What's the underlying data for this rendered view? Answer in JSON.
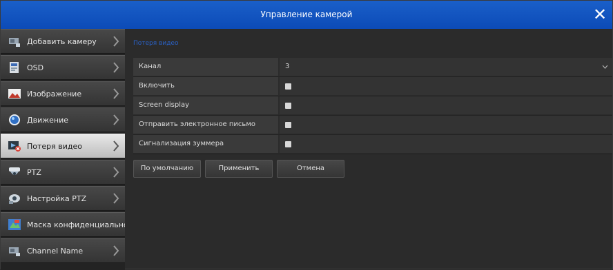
{
  "window": {
    "title": "Управление камерой",
    "close_icon": "close-icon"
  },
  "sidebar": {
    "items": [
      {
        "label": "Добавить камеру",
        "icon": "add-camera-icon",
        "active": false
      },
      {
        "label": "OSD",
        "icon": "osd-icon",
        "active": false
      },
      {
        "label": "Изображение",
        "icon": "image-icon",
        "active": false
      },
      {
        "label": "Движение",
        "icon": "motion-icon",
        "active": false
      },
      {
        "label": "Потеря видео",
        "icon": "video-loss-icon",
        "active": true
      },
      {
        "label": "PTZ",
        "icon": "ptz-icon",
        "active": false
      },
      {
        "label": "Настройка PTZ",
        "icon": "ptz-settings-icon",
        "active": false
      },
      {
        "label": "Маска конфиденциальнос",
        "icon": "privacy-mask-icon",
        "active": false
      },
      {
        "label": "Channel Name",
        "icon": "channel-name-icon",
        "active": false
      }
    ]
  },
  "main": {
    "section_title": "Потеря видео",
    "rows": [
      {
        "label": "Канал",
        "value": "3",
        "type": "select"
      },
      {
        "label": "Включить",
        "type": "checkbox"
      },
      {
        "label": "Screen display",
        "type": "checkbox"
      },
      {
        "label": "Отправить электронное письмо",
        "type": "checkbox"
      },
      {
        "label": "Сигнализация зуммера",
        "type": "checkbox"
      }
    ],
    "buttons": {
      "default": "По умолчанию",
      "apply": "Применить",
      "cancel": "Отмена"
    }
  },
  "colors": {
    "titlebar": "#1659c4",
    "accent_text": "#2a62c8",
    "background": "#2b2b2b"
  }
}
